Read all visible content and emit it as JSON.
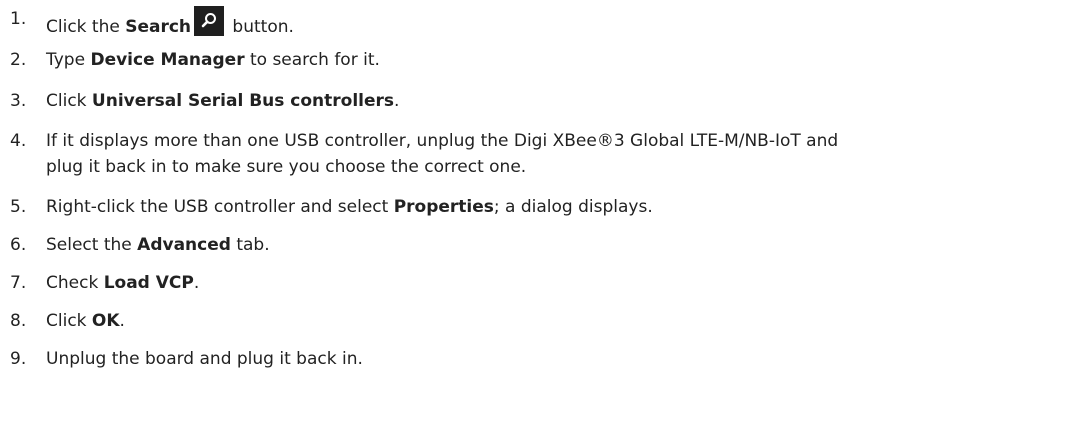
{
  "steps": [
    {
      "number": "1.",
      "pre": "Click the ",
      "bold": "Search",
      "post": " button."
    },
    {
      "number": "2.",
      "pre": "Type ",
      "bold": "Device Manager",
      "post": " to search for it."
    },
    {
      "number": "3.",
      "pre": "Click ",
      "bold": "Universal Serial Bus controllers",
      "post": "."
    },
    {
      "number": "4.",
      "line1": "If it displays more than one USB controller, unplug the Digi XBee®3 Global LTE-M/NB-IoT and",
      "line2": "plug it back in to make sure you choose the correct one."
    },
    {
      "number": "5.",
      "pre": "Right-click the USB controller and select ",
      "bold": "Properties",
      "post": "; a dialog displays."
    },
    {
      "number": "6.",
      "pre": "Select the ",
      "bold": "Advanced",
      "post": " tab."
    },
    {
      "number": "7.",
      "pre": "Check ",
      "bold": "Load VCP",
      "post": "."
    },
    {
      "number": "8.",
      "pre": "Click ",
      "bold": "OK",
      "post": "."
    },
    {
      "number": "9.",
      "text": "Unplug the board and plug it back in."
    }
  ],
  "icons": {
    "search": "search-icon"
  }
}
